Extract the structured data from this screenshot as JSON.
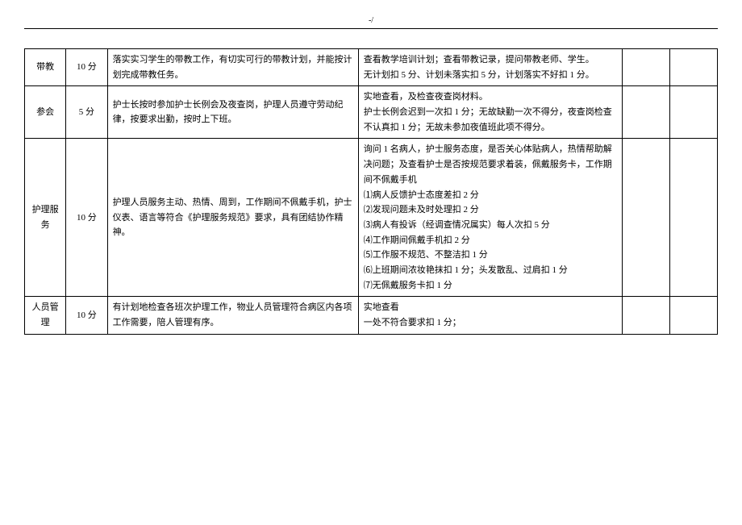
{
  "pageMark": "-/",
  "rows": [
    {
      "category": "带教",
      "score": "10 分",
      "description": "落实实习学生的带教工作，有切实可行的带教计划，并能按计划完成带教任务。",
      "method": "查看教学培训计划；查看带教记录，提问带教老师、学生。\n无计划扣 5 分、计划未落实扣 5 分，计划落实不好扣 1 分。"
    },
    {
      "category": "参会",
      "score": "5 分",
      "description": "护士长按时参加护士长例会及夜查岗，护理人员遵守劳动纪律，按要求出勤，按时上下班。",
      "method": "实地查看，及检查夜查岗材料。\n护士长例会迟到一次扣 1 分；无故缺勤一次不得分，夜查岗检查不认真扣 1 分；无故未参加夜值班此项不得分。"
    },
    {
      "category": "护理服务",
      "score": "10 分",
      "description": "护理人员服务主动、热情、周到，工作期间不佩戴手机，护士仪表、语言等符合《护理服务规范》要求，具有团结协作精神。",
      "method": "询问 1 名病人，护士服务态度，是否关心体贴病人，热情帮助解决问题；及查看护士是否按规范要求着装，佩戴服务卡，工作期间不佩戴手机\n⑴病人反馈护士态度差扣 2 分\n⑵发现问题未及时处理扣 2 分\n⑶病人有投诉（经调查情况属实）每人次扣 5 分\n⑷工作期间佩戴手机扣 2 分\n⑸工作服不规范、不整洁扣 1 分\n⑹上班期间浓妆艳抹扣 1 分；头发散乱、过肩扣 1 分\n⑺无佩戴服务卡扣 1 分"
    },
    {
      "category": "人员管理",
      "score": "10 分",
      "description": "有计划地检查各班次护理工作，物业人员管理符合病区内各项工作需要，陪人管理有序。",
      "method": "实地查看\n一处不符合要求扣 1 分；"
    }
  ]
}
